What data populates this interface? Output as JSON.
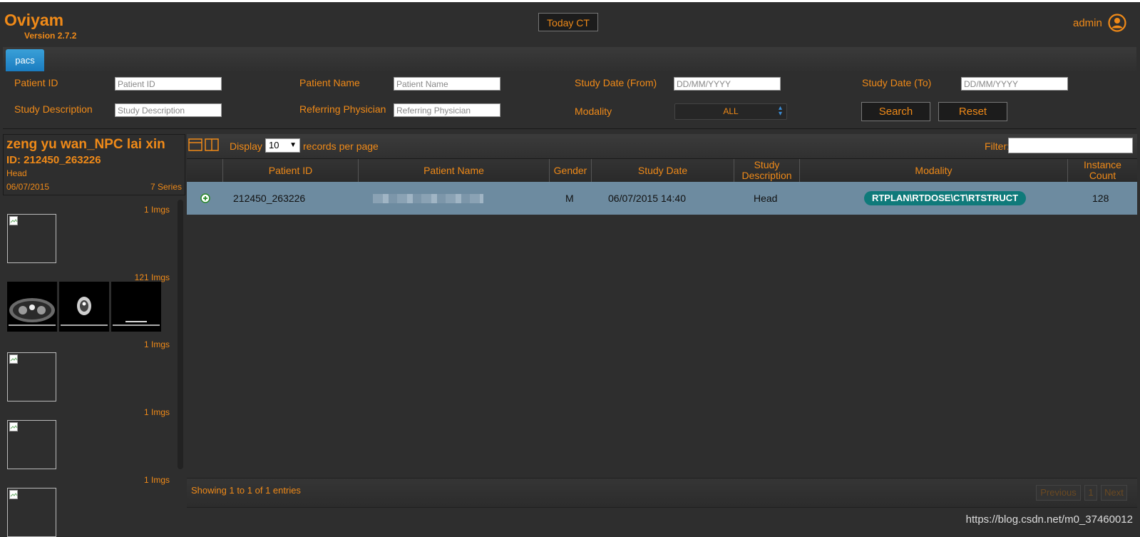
{
  "header": {
    "app_title": "Oviyam",
    "version": "Version 2.7.2",
    "today_button": "Today CT",
    "user": "admin"
  },
  "tabs": [
    {
      "label": "pacs",
      "active": true
    }
  ],
  "search": {
    "patient_id_label": "Patient ID",
    "patient_id_placeholder": "Patient ID",
    "patient_name_label": "Patient Name",
    "patient_name_placeholder": "Patient Name",
    "study_date_from_label": "Study Date (From)",
    "study_date_from_placeholder": "DD/MM/YYYY",
    "study_date_to_label": "Study Date (To)",
    "study_date_to_placeholder": "DD/MM/YYYY",
    "study_desc_label": "Study Description",
    "study_desc_placeholder": "Study Description",
    "referring_label": "Referring Physician",
    "referring_placeholder": "Referring Physician",
    "modality_label": "Modality",
    "modality_value": "ALL",
    "search_button": "Search",
    "reset_button": "Reset"
  },
  "patient_card": {
    "name": "zeng yu wan_NPC lai xin",
    "id": "ID: 212450_263226",
    "description": "Head",
    "date": "06/07/2015",
    "series_count": "7 Series"
  },
  "series": [
    {
      "count": "1 Imgs"
    },
    {
      "count": "121 Imgs"
    },
    {
      "count": "1 Imgs"
    },
    {
      "count": "1 Imgs"
    },
    {
      "count": "1 Imgs"
    }
  ],
  "toolbar": {
    "display_label": "Display",
    "records_value": "10",
    "records_label": "records per page",
    "filter_label": "Filter:"
  },
  "table": {
    "headers": {
      "patient_id": "Patient ID",
      "patient_name": "Patient Name",
      "gender": "Gender",
      "study_date": "Study Date",
      "study_desc_1": "Study",
      "study_desc_2": "Description",
      "modality": "Modality",
      "instance_1": "Instance",
      "instance_2": "Count"
    },
    "rows": [
      {
        "patient_id": "212450_263226",
        "gender": "M",
        "study_date": "06/07/2015 14:40",
        "study_desc": "Head",
        "modality": "RTPLAN\\RTDOSE\\CT\\RTSTRUCT",
        "instance_count": "128"
      }
    ]
  },
  "footer": {
    "showing": "Showing 1 to 1 of 1 entries",
    "previous": "Previous",
    "page": "1",
    "next": "Next"
  },
  "watermark": "https://blog.csdn.net/m0_37460012",
  "colors": {
    "accent": "#f08a18",
    "tab": "#1a7cc0",
    "row_selected": "#6d8ba0",
    "modality_pill": "#0f7a7a"
  }
}
